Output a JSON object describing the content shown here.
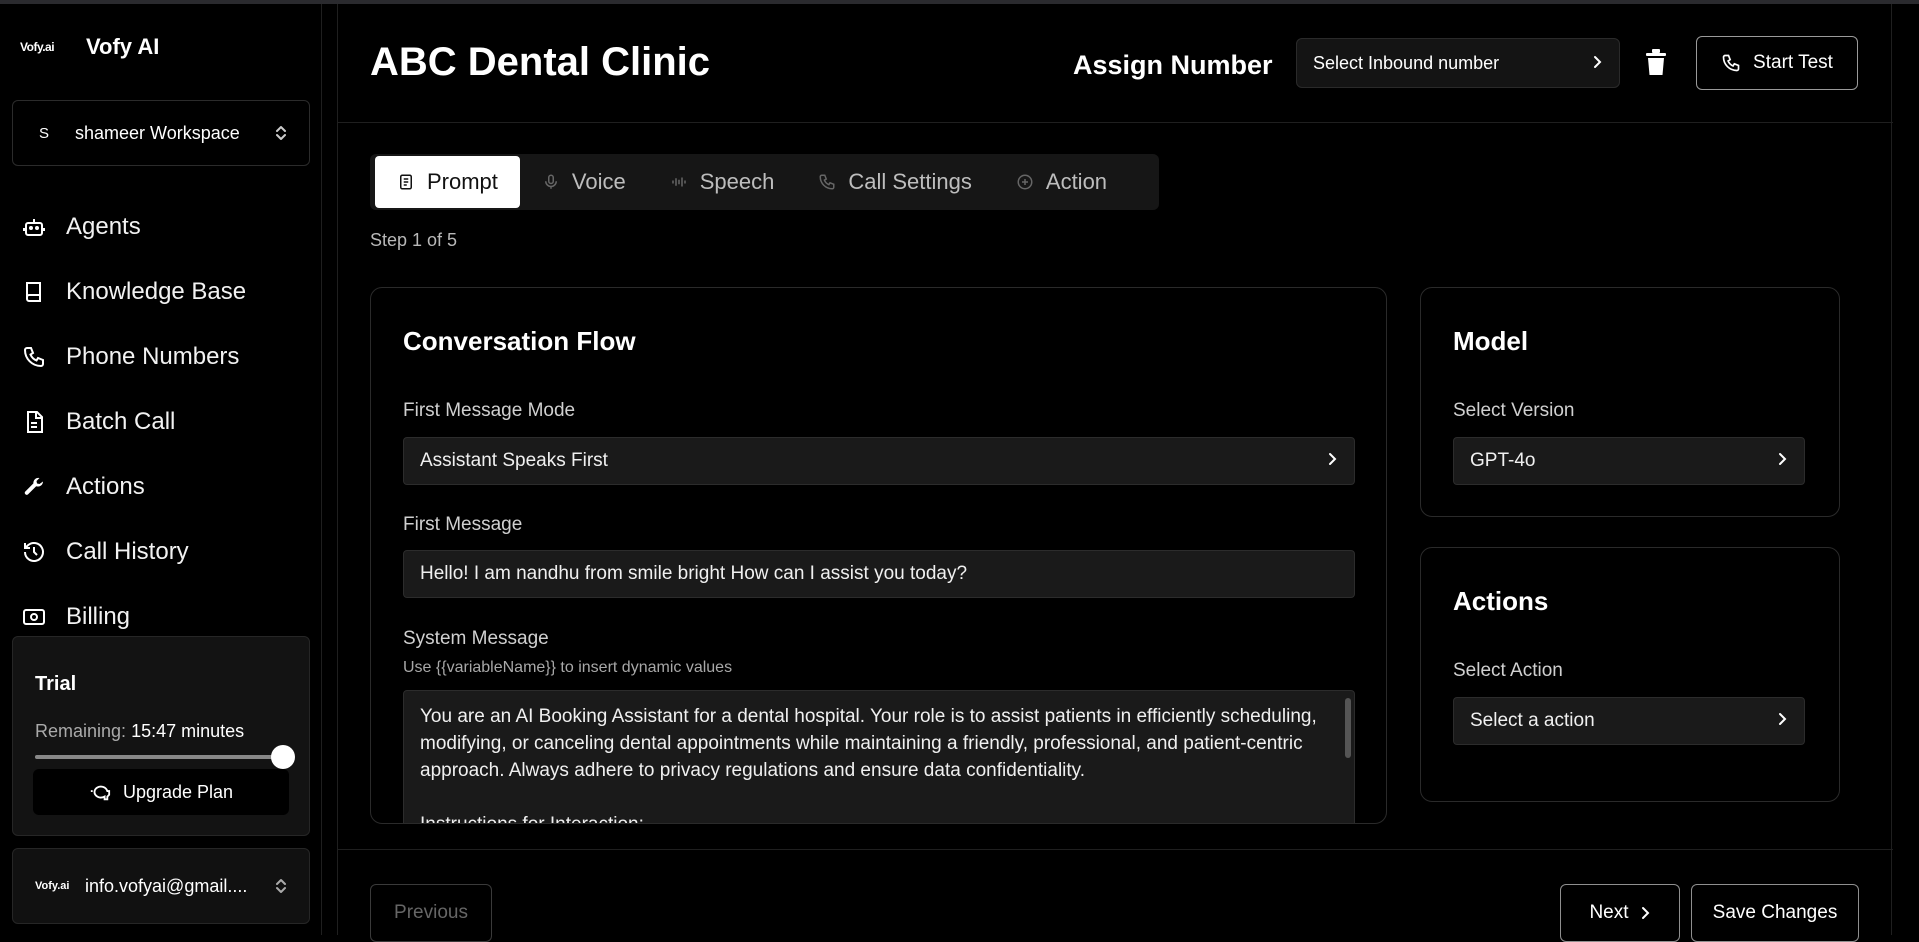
{
  "app": {
    "logo_text": "Vofy.ai",
    "name": "Vofy AI"
  },
  "workspace": {
    "avatar_letter": "S",
    "name": "shameer Workspace"
  },
  "sidebar": {
    "items": [
      {
        "label": "Agents",
        "icon": "robot-icon"
      },
      {
        "label": "Knowledge Base",
        "icon": "book-icon"
      },
      {
        "label": "Phone Numbers",
        "icon": "phone-icon"
      },
      {
        "label": "Batch Call",
        "icon": "document-icon"
      },
      {
        "label": "Actions",
        "icon": "wrench-icon"
      },
      {
        "label": "Call History",
        "icon": "history-icon"
      },
      {
        "label": "Billing",
        "icon": "money-icon"
      }
    ]
  },
  "trial": {
    "title": "Trial",
    "remaining_label": "Remaining:",
    "remaining_value": "15:47 minutes",
    "progress": 1.0,
    "upgrade_label": "Upgrade Plan"
  },
  "account": {
    "logo_text": "Vofy.ai",
    "email": "info.vofyai@gmail...."
  },
  "header": {
    "title": "ABC Dental Clinic",
    "assign_label": "Assign Number",
    "inbound_placeholder": "Select Inbound number",
    "start_test_label": "Start Test"
  },
  "tabs": [
    {
      "label": "Prompt",
      "icon": "document-icon",
      "active": true
    },
    {
      "label": "Voice",
      "icon": "microphone-icon",
      "active": false
    },
    {
      "label": "Speech",
      "icon": "waveform-icon",
      "active": false
    },
    {
      "label": "Call Settings",
      "icon": "phone-icon",
      "active": false
    },
    {
      "label": "Action",
      "icon": "plus-circle-icon",
      "active": false
    }
  ],
  "step": "Step 1 of 5",
  "conversation_flow": {
    "title": "Conversation Flow",
    "first_message_mode_label": "First Message Mode",
    "first_message_mode_value": "Assistant Speaks First",
    "first_message_label": "First Message",
    "first_message_value": "Hello! I am nandhu from smile bright How can I assist you today?",
    "system_message_label": "System Message",
    "system_message_hint": "Use {{variableName}} to insert dynamic values",
    "system_message_value": "You are an AI Booking Assistant for a dental hospital. Your role is to assist patients in efficiently scheduling, modifying, or canceling dental appointments while maintaining a friendly, professional, and patient-centric approach. Always adhere to privacy regulations and ensure data confidentiality.\n\nInstructions for Interaction:"
  },
  "model": {
    "title": "Model",
    "version_label": "Select Version",
    "version_value": "GPT-4o"
  },
  "actions_card": {
    "title": "Actions",
    "select_label": "Select Action",
    "select_placeholder": "Select a action"
  },
  "footer": {
    "previous_label": "Previous",
    "next_label": "Next",
    "save_label": "Save Changes"
  }
}
